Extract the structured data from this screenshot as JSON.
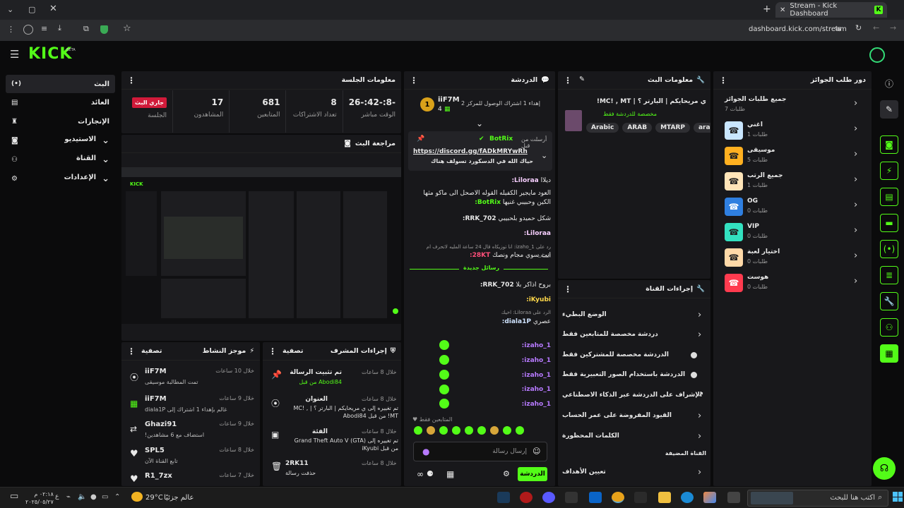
{
  "browser": {
    "tab_title": "Stream - Kick Dashboard",
    "url": "dashboard.kick.com/stream"
  },
  "brand": {
    "logo": "KICK",
    "beta": "BETA",
    "accent": "#53fc18"
  },
  "sidebar": {
    "items": [
      {
        "label": "البث",
        "icon": "broadcast-icon"
      },
      {
        "label": "العائد",
        "icon": "monetization-icon"
      },
      {
        "label": "الإنجازات",
        "icon": "trophy-icon"
      },
      {
        "label": "الاستيديو",
        "icon": "studio-icon"
      },
      {
        "label": "القناة",
        "icon": "channel-icon"
      },
      {
        "label": "الإعدادات",
        "icon": "gear-icon"
      }
    ]
  },
  "session": {
    "title": "معلومات الجلسة",
    "stats": [
      {
        "value": "-8:-42:-26",
        "label": "الوقت مباشر"
      },
      {
        "value": "8",
        "label": "تعداد الاشتراكات"
      },
      {
        "value": "681",
        "label": "المتابعين"
      },
      {
        "value": "17",
        "label": "المشاهدون"
      }
    ],
    "live_badge": "جاري البث",
    "session_label": "الجلسة"
  },
  "preview": {
    "title": "مراجعة البث"
  },
  "chat": {
    "title": "الدردشة",
    "pinned_user": "iiF7M",
    "pinned_count": "4",
    "pinned_sub": "إهداء 1 اشتراك الوصول للمركز 2",
    "pin_from": "أرسلت من قبل",
    "pin_user": "BotRix",
    "pin_link": "https://discord.gg/fADkMRYwRh",
    "pin_text": "حياك الله في الدسكورد تسولف هناك",
    "new_messages": "رسائل جديدة",
    "lines": [
      {
        "user": "Liloraa:",
        "text": "ديلاا"
      },
      {
        "user": "BotRix:",
        "text": "العود مايجير الكفيله القوله الاصحل الى ماكو مثها الكين وحبيبي غنيها"
      },
      {
        "user": "RRK_702:",
        "text": "شكل حميدو بلحبيبي"
      },
      {
        "user": "Liloraa:",
        "text": ""
      },
      {
        "user": "",
        "text": "رد على izaho_1: انا توزيكاه قال 24 ساعة المليه لاتحرف ام الشات"
      },
      {
        "user": "28KT:",
        "text": "انت سوي مجام ونصك"
      },
      {
        "user": "RRK_702:",
        "text": "بروح اذاكر بلا"
      },
      {
        "user": "iKyubi:",
        "text": ""
      },
      {
        "user": "",
        "text": "الرد على Liloraa: اخيك"
      },
      {
        "user": "diala1P:",
        "text": "عصري"
      },
      {
        "user": "izaho_1:",
        "text": ""
      },
      {
        "user": "izaho_1:",
        "text": ""
      },
      {
        "user": "izaho_1:",
        "text": ""
      },
      {
        "user": "izaho_1:",
        "text": ""
      },
      {
        "user": "izaho_1:",
        "text": ""
      }
    ],
    "followers_only": "المتابعين فقط",
    "input_placeholder": "إرسال رسالة",
    "send_label": "الدردشة"
  },
  "stream_info": {
    "title": "معلومات البث",
    "stream_title": "ي مريحايكم | البارتر ؟ | MC! , MT!",
    "category": "مخصصة للدردشة فقط",
    "tags": [
      "Arabic",
      "ARAB",
      "MTARP",
      "arabalc"
    ]
  },
  "channel_actions": {
    "title": "إجراءات القناة",
    "items": [
      {
        "label": "الوضع البطيء",
        "control": "chevron"
      },
      {
        "label": "دردشة مخصصة للمتابعين فقط",
        "control": "chevron"
      },
      {
        "label": "الدردشة مخصصة للمشتركين فقط",
        "control": "toggle"
      },
      {
        "label": "الدردشة باستخدام الصور التعبيرية فقط",
        "control": "toggle"
      },
      {
        "label": "الإشراف على الدردشة عبر الذكاء الاصطناعي",
        "control": "external"
      },
      {
        "label": "القيود المفروضة على عمر الحساب",
        "control": "chevron"
      },
      {
        "label": "الكلمات المحظورة",
        "control": "chevron"
      }
    ],
    "section_label": "القناة المضيفة",
    "goals_label": "تعيين الأهداف"
  },
  "rewards": {
    "title": "دور طلب الجوائز",
    "items": [
      {
        "name": "جميع طلبات الجوائز",
        "count": "طلبات 7",
        "color": "#18181b",
        "icon": ""
      },
      {
        "name": "اغني",
        "count": "طلبات 1",
        "color": "#c9e6ff",
        "icon": "☎"
      },
      {
        "name": "موسيقى",
        "count": "طلبات 5",
        "color": "#ffb020",
        "icon": "☎"
      },
      {
        "name": "جميع الرتب",
        "count": "طلبات 1",
        "color": "#ffe4b8",
        "icon": "☎"
      },
      {
        "name": "OG",
        "count": "طلبات 0",
        "color": "#2f7fe0",
        "icon": "☎"
      },
      {
        "name": "VIP",
        "count": "طلبات 0",
        "color": "#33e1c0",
        "icon": "☎"
      },
      {
        "name": "اختيار لعبة",
        "count": "طلبات 0",
        "color": "#ffd9a8",
        "icon": "☎"
      },
      {
        "name": "هوست",
        "count": "طلبات 0",
        "color": "#ff3b4f",
        "icon": "☎"
      }
    ]
  },
  "activity": {
    "title": "موجز النشاط",
    "filter": "تصفية",
    "items": [
      {
        "user": "iiF7M",
        "time": "خلال 10 ساعات",
        "text": "تمت المطالبة موسيقى",
        "icon": "reward-icon"
      },
      {
        "user": "iiF7M",
        "time": "خلال 9 ساعات",
        "text": "diala1P غالم بإهداء 1 اشتراك إلى",
        "icon": "gift-icon"
      },
      {
        "user": "Ghazi91",
        "time": "خلال 9 ساعات",
        "text": "!استضاف مع 6 مشاهدين",
        "icon": "host-icon"
      },
      {
        "user": "SPL5",
        "time": "خلال 8 ساعات",
        "text": "تابع القناة الآن",
        "icon": "heart-icon"
      },
      {
        "user": "R1_7zx",
        "time": "خلال 7 ساعات",
        "text": "",
        "icon": "heart-icon"
      }
    ]
  },
  "mod_actions": {
    "title": "إجراءات المشرف",
    "filter": "تصفية",
    "items": [
      {
        "title": "تم تثبيت الرسالة",
        "time": "خلال 8 ساعات",
        "text": "من قبل Abodi84",
        "icon": "pin-icon"
      },
      {
        "title": "العنوان",
        "time": "خلال 8 ساعات",
        "text": "تم تغييره إلى ي مريحايكم | البارتر ؟ | MC! , MT! من قبل Abodi84",
        "icon": "title-icon"
      },
      {
        "title": "الفئة",
        "time": "خلال 8 ساعات",
        "text": "تم تغييره إلى Grand Theft Auto V (GTA) من قبل iKyubi",
        "icon": "category-icon"
      },
      {
        "title": "2RK11",
        "time": "خلال 8 ساعات",
        "text": "حذفت رسالة",
        "icon": "trash-icon"
      }
    ]
  },
  "taskbar": {
    "search_placeholder": "اكتب هنا للبحث",
    "weather_temp": "29°C",
    "weather_text": "عالم جزئيًا",
    "time": "٠٢:١٨ م",
    "date": "٢٠٢٥/٠٥/٢٧"
  }
}
